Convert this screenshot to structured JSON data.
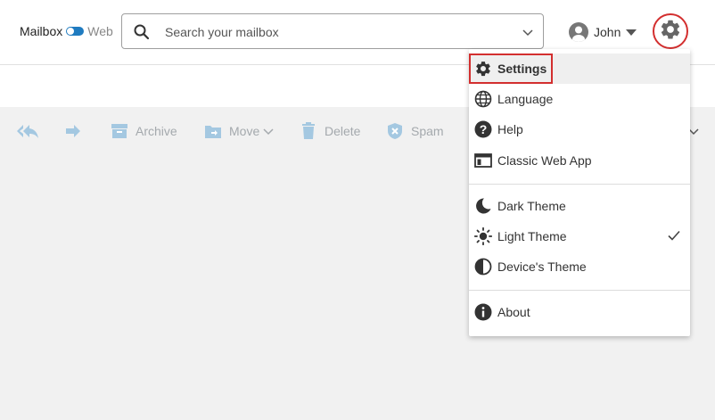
{
  "header": {
    "mode_left": "Mailbox",
    "mode_right": "Web",
    "search_placeholder": "Search your mailbox",
    "user_name": "John"
  },
  "toolbar": {
    "archive": "Archive",
    "move": "Move",
    "delete": "Delete",
    "spam": "Spam"
  },
  "menu": {
    "settings": "Settings",
    "language": "Language",
    "help": "Help",
    "classic": "Classic Web App",
    "dark": "Dark Theme",
    "light": "Light Theme",
    "device": "Device's Theme",
    "about": "About"
  },
  "state": {
    "selected_theme": "Light Theme"
  },
  "colors": {
    "accent": "#1f7bc0",
    "highlight_outline": "#d32f2f",
    "toolbar_icon": "#a4a9ad"
  }
}
